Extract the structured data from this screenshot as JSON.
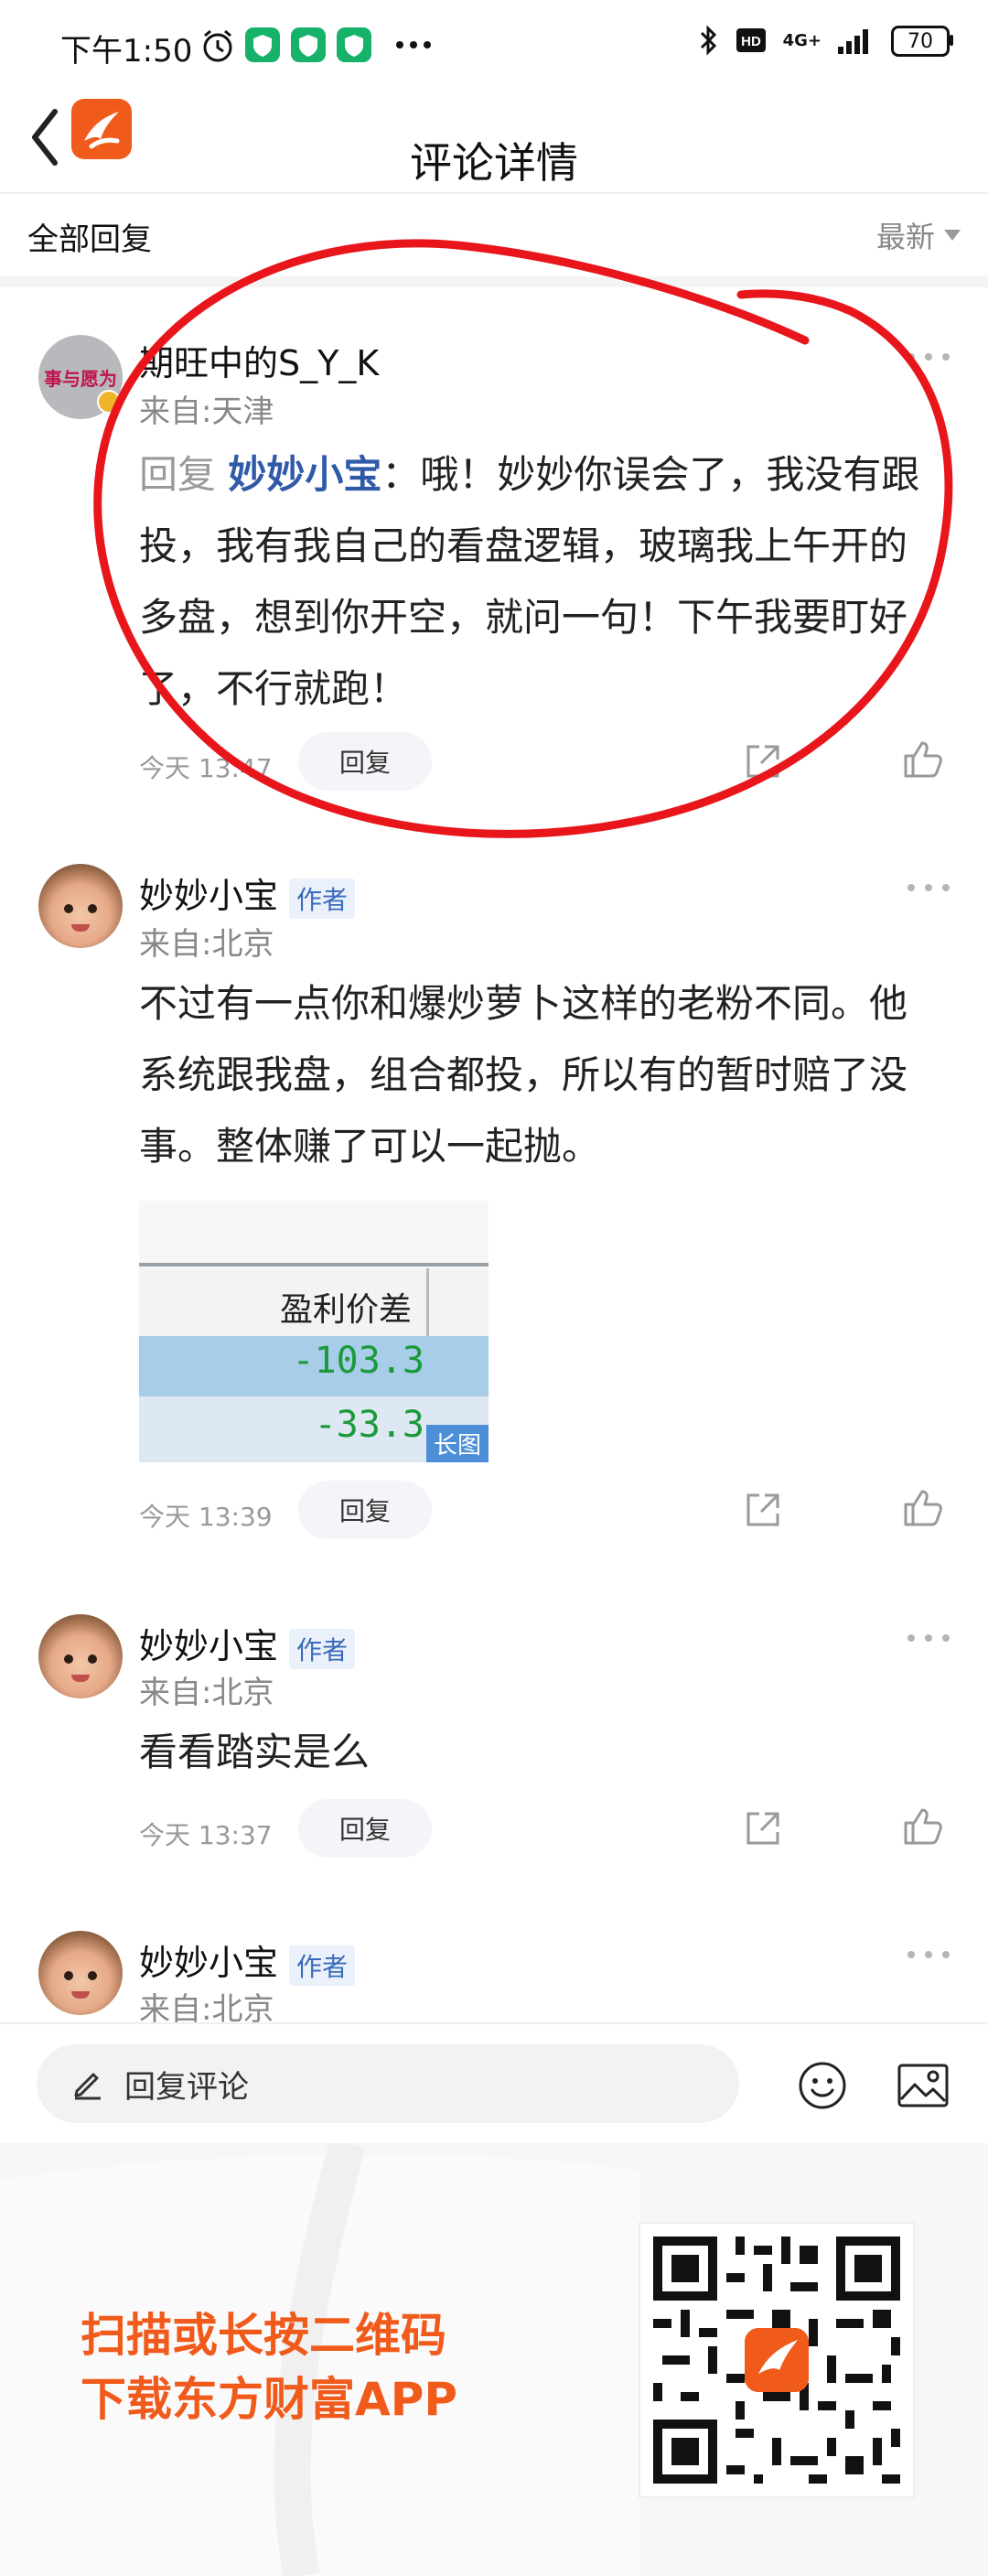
{
  "status_bar": {
    "time": "下午1:50",
    "network": "4G+",
    "battery": "70"
  },
  "header": {
    "title": "评论详情"
  },
  "filter": {
    "all_replies_label": "全部回复",
    "sort_label": "最新"
  },
  "comments": [
    {
      "user": "期旺中的S_Y_K",
      "from": "来自:天津",
      "reply_prefix": "回复",
      "mention": "妙妙小宝",
      "text": "：哦！妙妙你误会了，我没有跟投，我有我自己的看盘逻辑，玻璃我上午开的多盘，想到你开空，就问一句！下午我要盯好了，不行就跑！",
      "time": "今天 13:47",
      "reply_label": "回复",
      "avatar_text": "事与愿为"
    },
    {
      "user": "妙妙小宝",
      "author_tag": "作者",
      "from": "来自:北京",
      "text": "不过有一点你和爆炒萝卜这样的老粉不同。他系统跟我盘，组合都投，所以有的暂时赔了没事。整体赚了可以一起抛。",
      "time": "今天 13:39",
      "reply_label": "回复",
      "image": {
        "header": "盈利价差",
        "row1_value": "-103.3",
        "row2_value": "-33.3",
        "long_tag": "长图"
      }
    },
    {
      "user": "妙妙小宝",
      "author_tag": "作者",
      "from": "来自:北京",
      "text": "看看踏实是么",
      "time": "今天 13:37",
      "reply_label": "回复"
    },
    {
      "user": "妙妙小宝",
      "author_tag": "作者",
      "from": "来自:北京"
    }
  ],
  "input_bar": {
    "placeholder": "回复评论"
  },
  "promo": {
    "line1": "扫描或长按二维码",
    "line2": "下载东方财富APP"
  },
  "colors": {
    "brand_orange": "#f05a1a",
    "mention_blue": "#2e5aa8",
    "annotation_red": "#e8161b"
  }
}
